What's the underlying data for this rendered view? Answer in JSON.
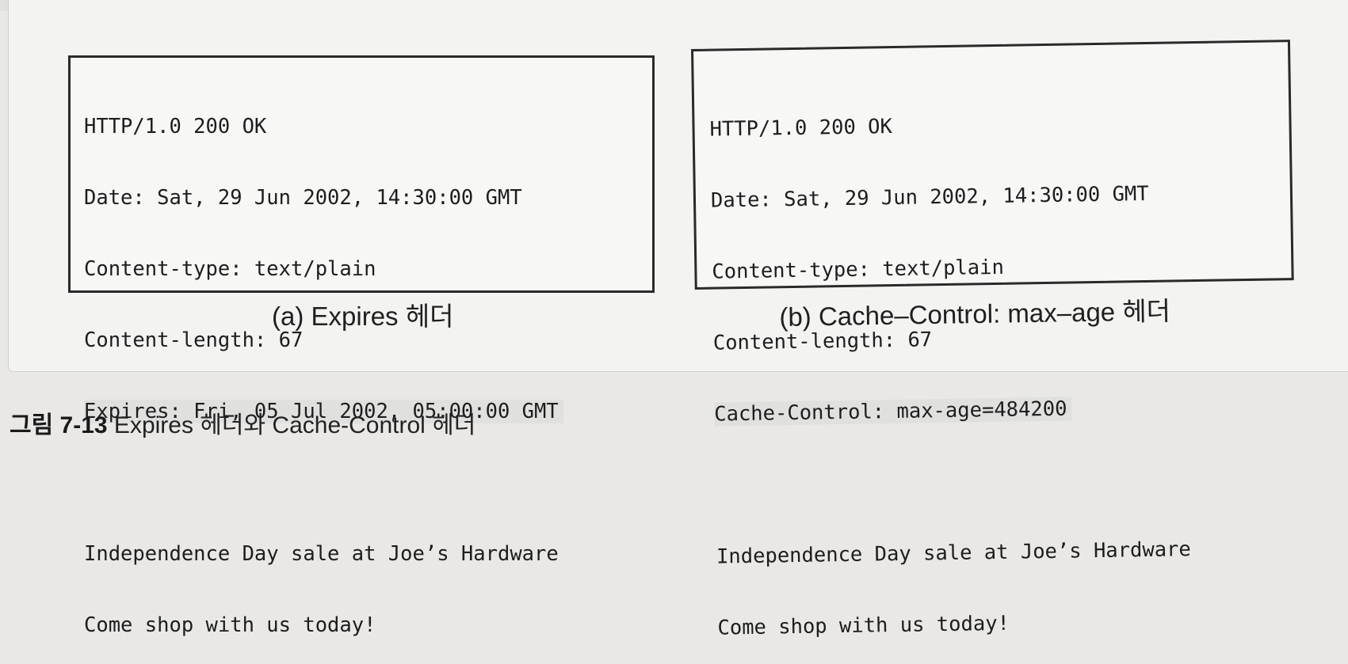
{
  "figure": {
    "number": "그림 7-13",
    "title": " Expires 헤더와 Cache-Control 헤더"
  },
  "panel_a": {
    "lines": [
      "HTTP/1.0 200 OK",
      "Date: Sat, 29 Jun 2002, 14:30:00 GMT",
      "Content-type: text/plain",
      "Content-length: 67"
    ],
    "highlighted_line": "Expires: Fri, 05 Jul 2002, 05:00:00 GMT",
    "body_lines": [
      "Independence Day sale at Joe’s Hardware",
      "Come shop with us today!"
    ],
    "caption_tag": "(a)",
    "caption_text": " Expires 헤더"
  },
  "panel_b": {
    "lines": [
      "HTTP/1.0 200 OK",
      "Date: Sat, 29 Jun 2002, 14:30:00 GMT",
      "Content-type: text/plain",
      "Content-length: 67"
    ],
    "highlighted_line": "Cache-Control: max-age=484200",
    "body_lines": [
      "Independence Day sale at Joe’s Hardware",
      "Come shop with us today!"
    ],
    "caption_tag": "(b)",
    "caption_text": " Cache–Control: max–age 헤더"
  },
  "colors": {
    "page_background": "#e9e8e6",
    "panel_background": "#f3f3f2",
    "box_border": "#2a2a2a",
    "highlight": "#e0e0df"
  }
}
